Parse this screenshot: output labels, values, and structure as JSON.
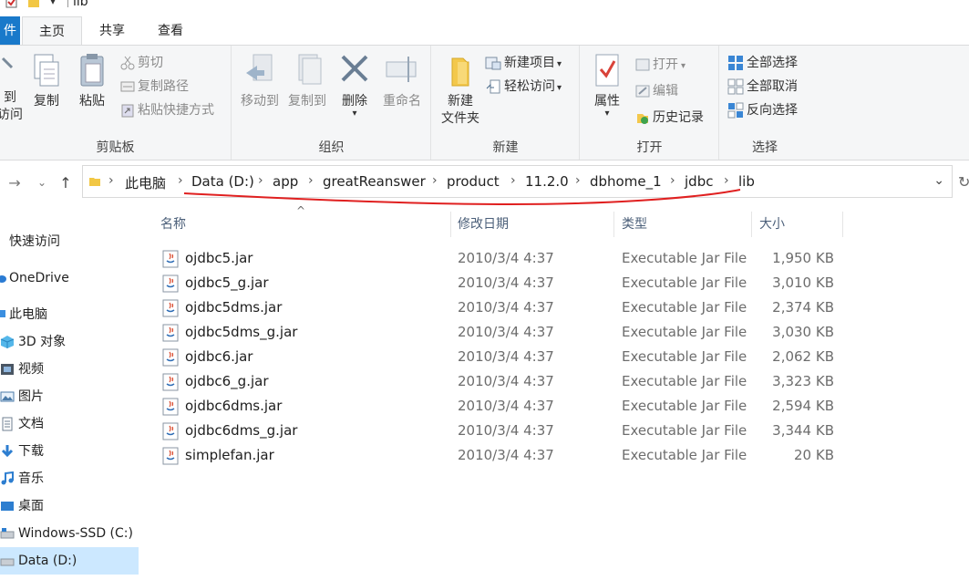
{
  "window": {
    "title": "lib"
  },
  "tabs": {
    "file": "件",
    "home": "主页",
    "share": "共享",
    "view": "查看"
  },
  "ribbon": {
    "clipboard": {
      "pin_label_1": "到",
      "pin_label_2": "访问",
      "copy": "复制",
      "paste": "粘贴",
      "cut": "剪切",
      "copy_path": "复制路径",
      "paste_shortcut": "粘贴快捷方式",
      "group": "剪贴板"
    },
    "organize": {
      "move_to": "移动到",
      "copy_to": "复制到",
      "delete": "删除",
      "rename": "重命名",
      "group": "组织"
    },
    "new": {
      "new_folder_1": "新建",
      "new_folder_2": "文件夹",
      "new_item": "新建项目",
      "easy_access": "轻松访问",
      "group": "新建"
    },
    "open": {
      "properties": "属性",
      "open": "打开",
      "edit": "编辑",
      "history": "历史记录",
      "group": "打开"
    },
    "select": {
      "select_all": "全部选择",
      "select_none": "全部取消",
      "invert": "反向选择",
      "group": "选择"
    }
  },
  "address": {
    "crumbs": [
      "此电脑",
      "Data (D:)",
      "app",
      "greatReanswer",
      "product",
      "11.2.0",
      "dbhome_1",
      "jdbc",
      "lib"
    ],
    "annotation_color": "#e02020"
  },
  "navpane": {
    "items": [
      "快速访问",
      "OneDrive",
      "此电脑",
      "3D 对象",
      "视频",
      "图片",
      "文档",
      "下载",
      "音乐",
      "桌面",
      "Windows-SSD (C:)",
      "Data (D:)"
    ],
    "selected": "Data (D:)"
  },
  "columns": {
    "name": "名称",
    "date": "修改日期",
    "type": "类型",
    "size": "大小"
  },
  "files": [
    {
      "name": "ojdbc5.jar",
      "date": "2010/3/4 4:37",
      "type": "Executable Jar File",
      "size": "1,950 KB"
    },
    {
      "name": "ojdbc5_g.jar",
      "date": "2010/3/4 4:37",
      "type": "Executable Jar File",
      "size": "3,010 KB"
    },
    {
      "name": "ojdbc5dms.jar",
      "date": "2010/3/4 4:37",
      "type": "Executable Jar File",
      "size": "2,374 KB"
    },
    {
      "name": "ojdbc5dms_g.jar",
      "date": "2010/3/4 4:37",
      "type": "Executable Jar File",
      "size": "3,030 KB"
    },
    {
      "name": "ojdbc6.jar",
      "date": "2010/3/4 4:37",
      "type": "Executable Jar File",
      "size": "2,062 KB"
    },
    {
      "name": "ojdbc6_g.jar",
      "date": "2010/3/4 4:37",
      "type": "Executable Jar File",
      "size": "3,323 KB"
    },
    {
      "name": "ojdbc6dms.jar",
      "date": "2010/3/4 4:37",
      "type": "Executable Jar File",
      "size": "2,594 KB"
    },
    {
      "name": "ojdbc6dms_g.jar",
      "date": "2010/3/4 4:37",
      "type": "Executable Jar File",
      "size": "3,344 KB"
    },
    {
      "name": "simplefan.jar",
      "date": "2010/3/4 4:37",
      "type": "Executable Jar File",
      "size": "20 KB"
    }
  ]
}
